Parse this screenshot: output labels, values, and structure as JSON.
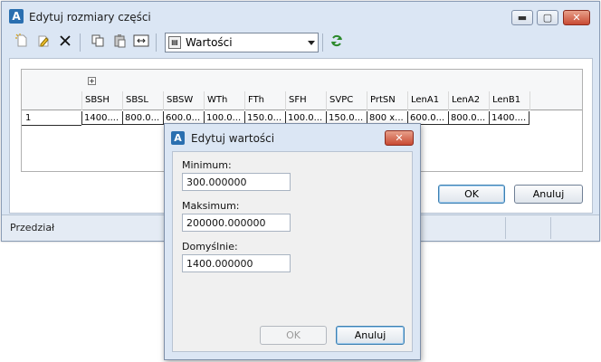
{
  "main_window": {
    "title": "Edytuj rozmiary części",
    "controls": {
      "minimize": "▬",
      "maximize": "▢",
      "close": "✕"
    },
    "toolbar": {
      "value_selector": {
        "selected": "Wartości"
      }
    },
    "grid": {
      "expand_glyph": "+",
      "columns": [
        "SBSH",
        "SBSL",
        "SBSW",
        "WTh",
        "FTh",
        "SFH",
        "SVPC",
        "PrtSN",
        "LenA1",
        "LenA2",
        "LenB1"
      ],
      "rows": [
        {
          "index": "1",
          "cells": [
            "1400....",
            "800.0...",
            "600.0...",
            "100.0...",
            "150.0...",
            "100.0...",
            "150.0...",
            "800 x...",
            "600.0...",
            "800.0...",
            "1400...."
          ]
        }
      ]
    },
    "buttons": {
      "ok": "OK",
      "cancel": "Anuluj"
    },
    "status": "Przedział"
  },
  "dialog": {
    "title": "Edytuj wartości",
    "close": "✕",
    "fields": {
      "minimum": {
        "label": "Minimum:",
        "value": "300.000000"
      },
      "maximum": {
        "label": "Maksimum:",
        "value": "200000.000000"
      },
      "default": {
        "label": "Domyślnie:",
        "value": "1400.000000"
      }
    },
    "buttons": {
      "ok": "OK",
      "cancel": "Anuluj"
    }
  },
  "colors": {
    "chrome": "#dbe6f4",
    "close_button": "#c84a33",
    "focus_border": "#3c7fb1"
  }
}
